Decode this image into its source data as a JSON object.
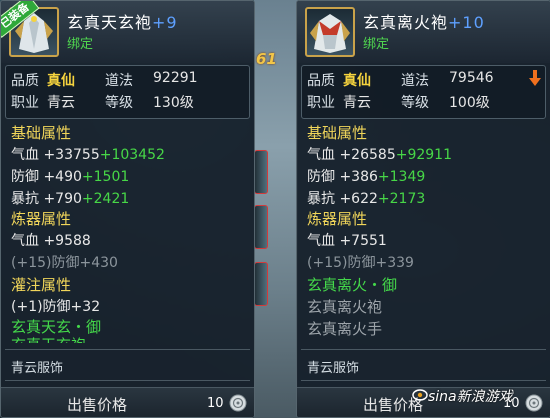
{
  "background": {
    "number": "61"
  },
  "left_panel": {
    "badge": "已装备",
    "name": "玄真天玄袍",
    "enhance": "+9",
    "bound": "绑定",
    "quality_label": "品质",
    "quality_value": "真仙",
    "daofa_label": "道法",
    "daofa_value": "92291",
    "job_label": "职业",
    "job_value": "青云",
    "level_label": "等级",
    "level_value": "130级",
    "base_title": "基础属性",
    "hp_label": "气血",
    "hp_base": "+33755",
    "hp_bonus": "+103452",
    "def_label": "防御",
    "def_base": "+490",
    "def_bonus": "+1501",
    "crit_label": "暴抗",
    "crit_base": "+790",
    "crit_bonus": "+2421",
    "refine_title": "炼器属性",
    "refine_hp": "气血 +9588",
    "refine_def": "(+15)防御+430",
    "infuse_title": "灌注属性",
    "infuse_def": "(+1)防御+32",
    "set_name": "玄真天玄・御",
    "set_clipped": "玄真天玄袍",
    "footer": "青云服饰",
    "sell_label": "出售价格",
    "sell_value": "10"
  },
  "right_panel": {
    "name": "玄真离火袍",
    "enhance": "+10",
    "bound": "绑定",
    "quality_label": "品质",
    "quality_value": "真仙",
    "daofa_label": "道法",
    "daofa_value": "79546",
    "job_label": "职业",
    "job_value": "青云",
    "level_label": "等级",
    "level_value": "100级",
    "base_title": "基础属性",
    "hp_label": "气血",
    "hp_base": "+26585",
    "hp_bonus": "+92911",
    "def_label": "防御",
    "def_base": "+386",
    "def_bonus": "+1349",
    "crit_label": "暴抗",
    "crit_base": "+622",
    "crit_bonus": "+2173",
    "refine_title": "炼器属性",
    "refine_hp": "气血 +7551",
    "refine_def": "(+15)防御+339",
    "set_name": "玄真离火・御",
    "set_item1": "玄真离火袍",
    "set_item2": "玄真离火手",
    "footer": "青云服饰",
    "sell_label": "出售价格",
    "sell_value": "10"
  },
  "watermark": "sina新浪游戏"
}
